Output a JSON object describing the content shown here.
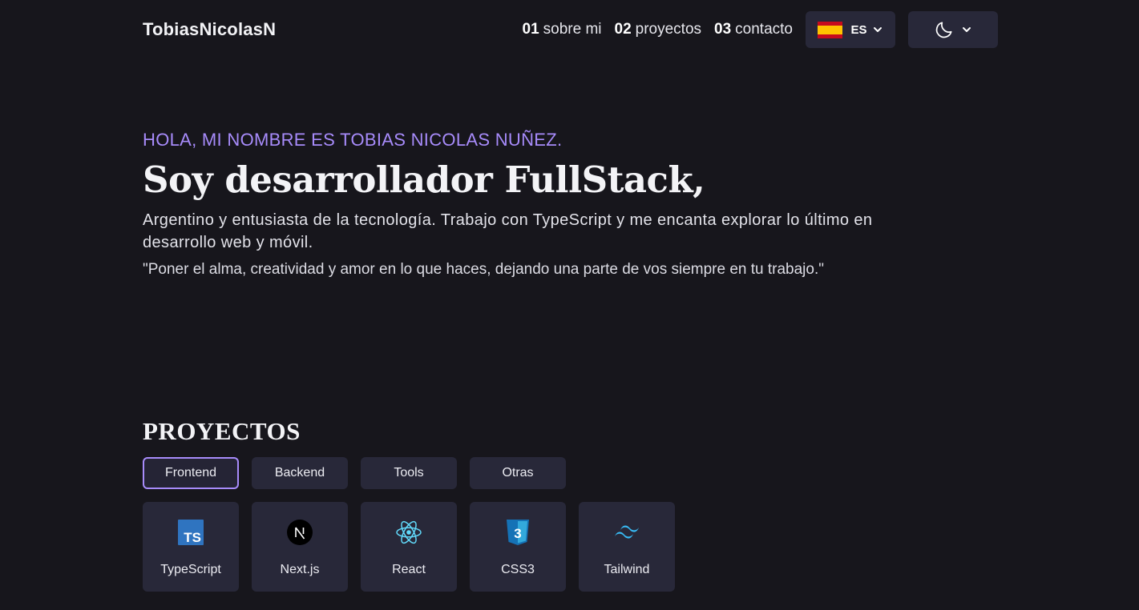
{
  "header": {
    "logo": "TobiasNicolasN",
    "nav": [
      {
        "num": "01",
        "label": "sobre mi"
      },
      {
        "num": "02",
        "label": "proyectos"
      },
      {
        "num": "03",
        "label": "contacto"
      }
    ],
    "language": {
      "code": "ES",
      "flag_icon": "spain-flag-icon"
    },
    "theme": {
      "icon": "moon-icon"
    }
  },
  "hero": {
    "greeting": "HOLA, MI NOMBRE ES TOBIAS NICOLAS NUÑEZ.",
    "headline": "Soy desarrollador FullStack,",
    "description": "Argentino y entusiasta de la tecnología. Trabajo con TypeScript y me encanta explorar lo último en desarrollo web y móvil.",
    "quote": "\"Poner el alma, creatividad y amor en lo que haces, dejando una parte de vos siempre en tu trabajo.\""
  },
  "projects": {
    "title": "PROYECTOS",
    "tabs": [
      {
        "label": "Frontend",
        "active": true
      },
      {
        "label": "Backend",
        "active": false
      },
      {
        "label": "Tools",
        "active": false
      },
      {
        "label": "Otras",
        "active": false
      }
    ],
    "cards": [
      {
        "label": "TypeScript",
        "icon": "typescript-icon"
      },
      {
        "label": "Next.js",
        "icon": "nextjs-icon"
      },
      {
        "label": "React",
        "icon": "react-icon"
      },
      {
        "label": "CSS3",
        "icon": "css3-icon"
      },
      {
        "label": "Tailwind",
        "icon": "tailwind-icon"
      }
    ]
  },
  "colors": {
    "background": "#17161c",
    "surface": "#282839",
    "accent": "#a78bfa"
  }
}
